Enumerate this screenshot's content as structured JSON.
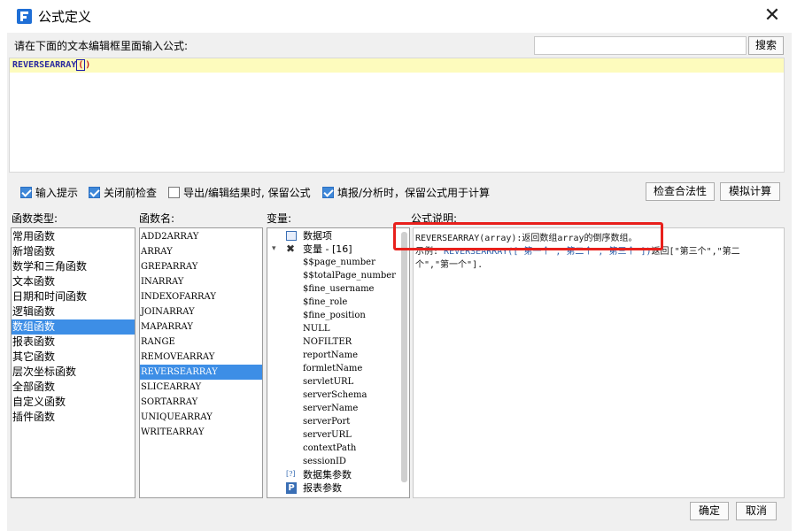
{
  "window": {
    "title": "公式定义",
    "close_glyph": "✕"
  },
  "editor": {
    "prompt": "请在下面的文本编辑框里面输入公式:",
    "search_placeholder": "",
    "search_button": "搜索",
    "formula_name": "REVERSEARRAY",
    "formula_open": "(",
    "formula_close": ")"
  },
  "options": {
    "input_hint": {
      "label": "输入提示",
      "checked": true
    },
    "check_before_close": {
      "label": "关闭前检查",
      "checked": true
    },
    "keep_formula_export": {
      "label": "导出/编辑结果时, 保留公式",
      "checked": false
    },
    "keep_formula_fill": {
      "label": "填报/分析时，保留公式用于计算",
      "checked": true
    },
    "check_validity_button": "检查合法性",
    "simulate_button": "模拟计算"
  },
  "categories": {
    "label": "函数类型:",
    "items": [
      "常用函数",
      "新增函数",
      "数学和三角函数",
      "文本函数",
      "日期和时间函数",
      "逻辑函数",
      "数组函数",
      "报表函数",
      "其它函数",
      "层次坐标函数",
      "全部函数",
      "自定义函数",
      "插件函数"
    ],
    "selected": "数组函数"
  },
  "functions": {
    "label": "函数名:",
    "items": [
      "ADD2ARRAY",
      "ARRAY",
      "GREPARRAY",
      "INARRAY",
      "INDEXOFARRAY",
      "JOINARRAY",
      "MAPARRAY",
      "RANGE",
      "REMOVEARRAY",
      "REVERSEARRAY",
      "SLICEARRAY",
      "SORTARRAY",
      "UNIQUEARRAY",
      "WRITEARRAY"
    ],
    "selected": "REVERSEARRAY"
  },
  "variables": {
    "label": "变量:",
    "data_items": "数据项",
    "variable_group": "变量 - [16]",
    "variable_items": [
      "$$page_number",
      "$$totalPage_number",
      "$fine_username",
      "$fine_role",
      "$fine_position",
      "NULL",
      "NOFILTER",
      "reportName",
      "formletName",
      "servletURL",
      "serverSchema",
      "serverName",
      "serverPort",
      "serverURL",
      "contextPath",
      "sessionID"
    ],
    "dataset_params": "数据集参数",
    "report_params": "报表参数",
    "dataset_icon_text": "[?]",
    "report_icon_text": "P"
  },
  "description": {
    "label": "公式说明:",
    "line1_code": "REVERSEARRAY(array)",
    "line1_rest": ":返回数组array的倒序数组。",
    "line2_prefix": "示例: ",
    "line2_code": "REVERSEARRAY([\"第一个\",\"第二个\",\"第三个\"])",
    "line2_rest": "返回[\"第三个\",\"第二",
    "line3": "个\",\"第一个\"]."
  },
  "footer": {
    "ok": "确定",
    "cancel": "取消"
  }
}
